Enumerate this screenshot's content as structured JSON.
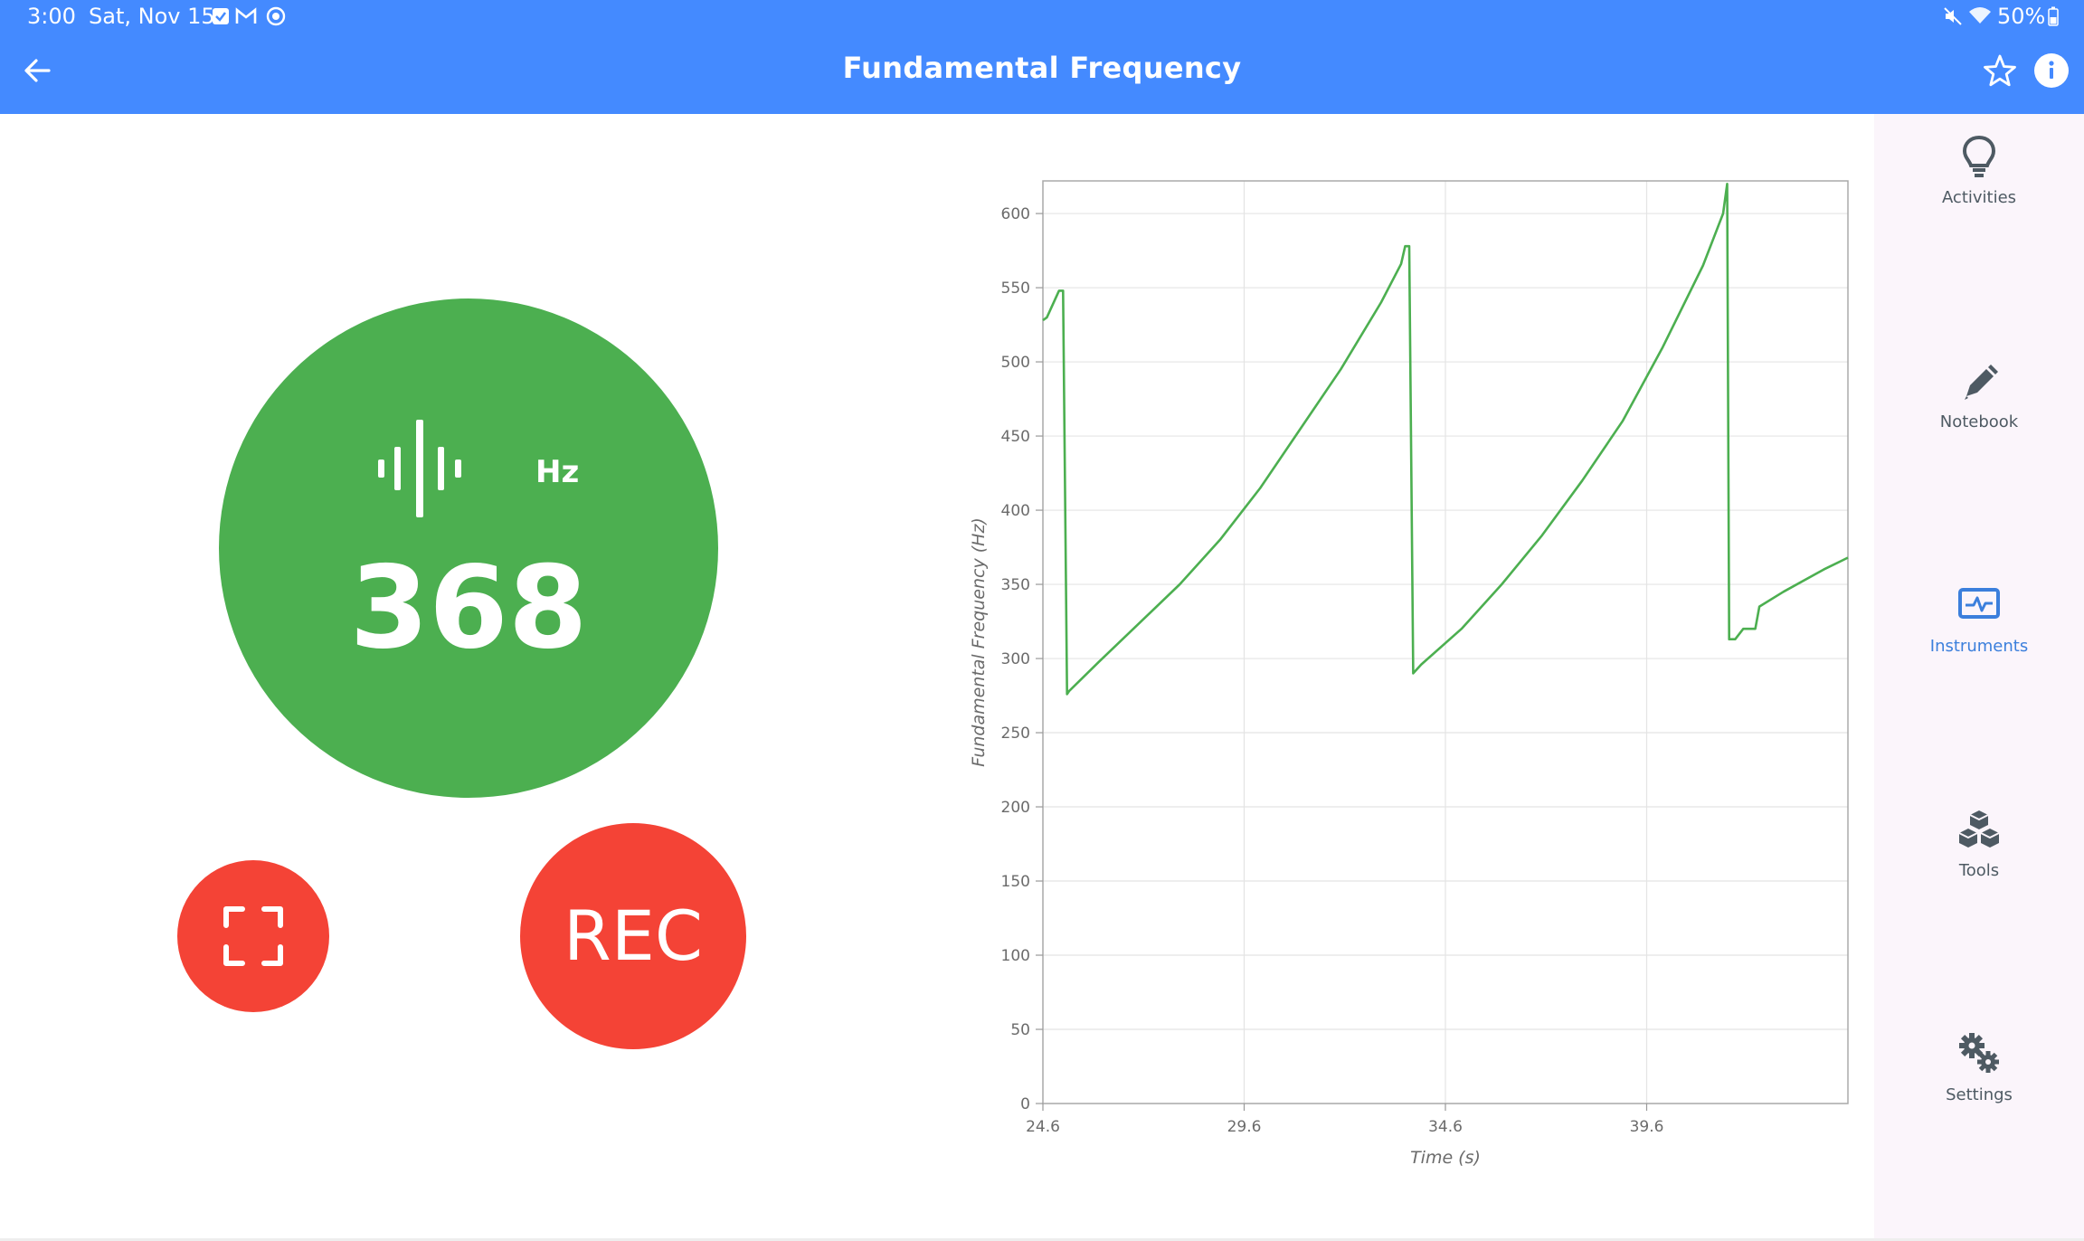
{
  "status_bar": {
    "time": "3:00",
    "date": "Sat, Nov 15",
    "notification_icons": [
      "checkbox-icon",
      "gmail-icon",
      "app-notification-icon"
    ],
    "system_icons": [
      "mute-icon",
      "wifi-icon",
      "battery-icon"
    ],
    "battery": "50%"
  },
  "appbar": {
    "title": "Fundamental Frequency",
    "background": "#448aff",
    "left_icon": "back-arrow-icon",
    "right_icons": [
      "star-outline-icon",
      "info-icon"
    ]
  },
  "meter": {
    "icon": "sound-wave-icon",
    "unit": "Hz",
    "value": "368",
    "color": "#4caf50"
  },
  "buttons": {
    "fullscreen_icon": "fullscreen-icon",
    "rec_label": "REC",
    "color": "#f44336"
  },
  "sidebar": {
    "items": [
      {
        "label": "Activities",
        "icon": "lightbulb-icon",
        "active": false
      },
      {
        "label": "Notebook",
        "icon": "pencil-icon",
        "active": false
      },
      {
        "label": "Instruments",
        "icon": "instrument-monitor-icon",
        "active": true
      },
      {
        "label": "Tools",
        "icon": "cubes-icon",
        "active": false
      },
      {
        "label": "Settings",
        "icon": "gears-icon",
        "active": false
      }
    ]
  },
  "chart_data": {
    "type": "line",
    "xlabel": "Time (s)",
    "ylabel": "Fundamental Frequency (Hz)",
    "xlim": [
      24.6,
      44.6
    ],
    "ylim": [
      0,
      622
    ],
    "xticks": [
      24.6,
      29.6,
      34.6,
      39.6
    ],
    "xtick_labels": [
      "24.6",
      "29.6",
      "34.6",
      "39.6"
    ],
    "yticks": [
      0,
      50,
      100,
      150,
      200,
      250,
      300,
      350,
      400,
      450,
      500,
      550,
      600
    ],
    "grid": true,
    "color": "#4caf50",
    "series": [
      {
        "x": [
          24.6,
          24.7,
          25.0,
          25.1,
          25.2,
          25.25,
          26.0,
          27.0,
          28.0,
          29.0,
          29.6,
          30.0,
          31.0,
          32.0,
          33.0,
          33.5,
          33.6,
          33.7,
          33.8,
          34.0,
          35.0,
          36.0,
          37.0,
          38.0,
          39.0,
          40.0,
          41.0,
          41.5,
          41.6,
          41.65,
          41.8,
          42.0,
          42.3,
          42.4,
          43.0,
          44.0,
          44.6
        ],
        "y": [
          528,
          530,
          548,
          548,
          276,
          278,
          298,
          324,
          350,
          380,
          401,
          415,
          455,
          495,
          540,
          566,
          578,
          578,
          290,
          296,
          320,
          350,
          383,
          420,
          460,
          510,
          565,
          600,
          620,
          313,
          313,
          320,
          320,
          335,
          345,
          360,
          368
        ]
      }
    ]
  }
}
